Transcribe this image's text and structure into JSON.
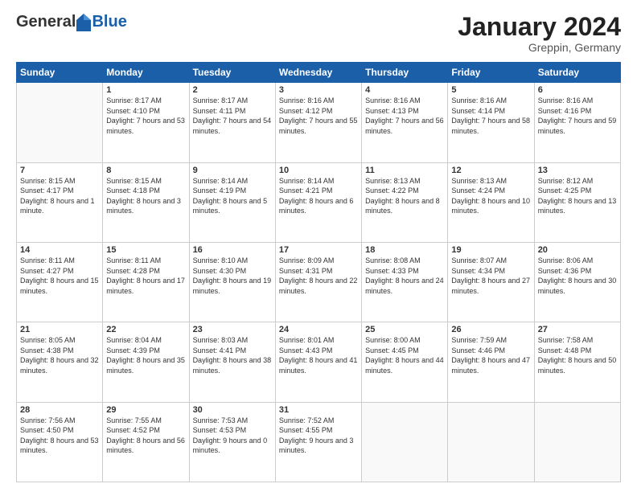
{
  "header": {
    "logo_general": "General",
    "logo_blue": "Blue",
    "month_title": "January 2024",
    "location": "Greppin, Germany"
  },
  "calendar": {
    "headers": [
      "Sunday",
      "Monday",
      "Tuesday",
      "Wednesday",
      "Thursday",
      "Friday",
      "Saturday"
    ],
    "weeks": [
      [
        {
          "day": "",
          "sunrise": "",
          "sunset": "",
          "daylight": "",
          "empty": true
        },
        {
          "day": "1",
          "sunrise": "Sunrise: 8:17 AM",
          "sunset": "Sunset: 4:10 PM",
          "daylight": "Daylight: 7 hours and 53 minutes."
        },
        {
          "day": "2",
          "sunrise": "Sunrise: 8:17 AM",
          "sunset": "Sunset: 4:11 PM",
          "daylight": "Daylight: 7 hours and 54 minutes."
        },
        {
          "day": "3",
          "sunrise": "Sunrise: 8:16 AM",
          "sunset": "Sunset: 4:12 PM",
          "daylight": "Daylight: 7 hours and 55 minutes."
        },
        {
          "day": "4",
          "sunrise": "Sunrise: 8:16 AM",
          "sunset": "Sunset: 4:13 PM",
          "daylight": "Daylight: 7 hours and 56 minutes."
        },
        {
          "day": "5",
          "sunrise": "Sunrise: 8:16 AM",
          "sunset": "Sunset: 4:14 PM",
          "daylight": "Daylight: 7 hours and 58 minutes."
        },
        {
          "day": "6",
          "sunrise": "Sunrise: 8:16 AM",
          "sunset": "Sunset: 4:16 PM",
          "daylight": "Daylight: 7 hours and 59 minutes."
        }
      ],
      [
        {
          "day": "7",
          "sunrise": "Sunrise: 8:15 AM",
          "sunset": "Sunset: 4:17 PM",
          "daylight": "Daylight: 8 hours and 1 minute."
        },
        {
          "day": "8",
          "sunrise": "Sunrise: 8:15 AM",
          "sunset": "Sunset: 4:18 PM",
          "daylight": "Daylight: 8 hours and 3 minutes."
        },
        {
          "day": "9",
          "sunrise": "Sunrise: 8:14 AM",
          "sunset": "Sunset: 4:19 PM",
          "daylight": "Daylight: 8 hours and 5 minutes."
        },
        {
          "day": "10",
          "sunrise": "Sunrise: 8:14 AM",
          "sunset": "Sunset: 4:21 PM",
          "daylight": "Daylight: 8 hours and 6 minutes."
        },
        {
          "day": "11",
          "sunrise": "Sunrise: 8:13 AM",
          "sunset": "Sunset: 4:22 PM",
          "daylight": "Daylight: 8 hours and 8 minutes."
        },
        {
          "day": "12",
          "sunrise": "Sunrise: 8:13 AM",
          "sunset": "Sunset: 4:24 PM",
          "daylight": "Daylight: 8 hours and 10 minutes."
        },
        {
          "day": "13",
          "sunrise": "Sunrise: 8:12 AM",
          "sunset": "Sunset: 4:25 PM",
          "daylight": "Daylight: 8 hours and 13 minutes."
        }
      ],
      [
        {
          "day": "14",
          "sunrise": "Sunrise: 8:11 AM",
          "sunset": "Sunset: 4:27 PM",
          "daylight": "Daylight: 8 hours and 15 minutes."
        },
        {
          "day": "15",
          "sunrise": "Sunrise: 8:11 AM",
          "sunset": "Sunset: 4:28 PM",
          "daylight": "Daylight: 8 hours and 17 minutes."
        },
        {
          "day": "16",
          "sunrise": "Sunrise: 8:10 AM",
          "sunset": "Sunset: 4:30 PM",
          "daylight": "Daylight: 8 hours and 19 minutes."
        },
        {
          "day": "17",
          "sunrise": "Sunrise: 8:09 AM",
          "sunset": "Sunset: 4:31 PM",
          "daylight": "Daylight: 8 hours and 22 minutes."
        },
        {
          "day": "18",
          "sunrise": "Sunrise: 8:08 AM",
          "sunset": "Sunset: 4:33 PM",
          "daylight": "Daylight: 8 hours and 24 minutes."
        },
        {
          "day": "19",
          "sunrise": "Sunrise: 8:07 AM",
          "sunset": "Sunset: 4:34 PM",
          "daylight": "Daylight: 8 hours and 27 minutes."
        },
        {
          "day": "20",
          "sunrise": "Sunrise: 8:06 AM",
          "sunset": "Sunset: 4:36 PM",
          "daylight": "Daylight: 8 hours and 30 minutes."
        }
      ],
      [
        {
          "day": "21",
          "sunrise": "Sunrise: 8:05 AM",
          "sunset": "Sunset: 4:38 PM",
          "daylight": "Daylight: 8 hours and 32 minutes."
        },
        {
          "day": "22",
          "sunrise": "Sunrise: 8:04 AM",
          "sunset": "Sunset: 4:39 PM",
          "daylight": "Daylight: 8 hours and 35 minutes."
        },
        {
          "day": "23",
          "sunrise": "Sunrise: 8:03 AM",
          "sunset": "Sunset: 4:41 PM",
          "daylight": "Daylight: 8 hours and 38 minutes."
        },
        {
          "day": "24",
          "sunrise": "Sunrise: 8:01 AM",
          "sunset": "Sunset: 4:43 PM",
          "daylight": "Daylight: 8 hours and 41 minutes."
        },
        {
          "day": "25",
          "sunrise": "Sunrise: 8:00 AM",
          "sunset": "Sunset: 4:45 PM",
          "daylight": "Daylight: 8 hours and 44 minutes."
        },
        {
          "day": "26",
          "sunrise": "Sunrise: 7:59 AM",
          "sunset": "Sunset: 4:46 PM",
          "daylight": "Daylight: 8 hours and 47 minutes."
        },
        {
          "day": "27",
          "sunrise": "Sunrise: 7:58 AM",
          "sunset": "Sunset: 4:48 PM",
          "daylight": "Daylight: 8 hours and 50 minutes."
        }
      ],
      [
        {
          "day": "28",
          "sunrise": "Sunrise: 7:56 AM",
          "sunset": "Sunset: 4:50 PM",
          "daylight": "Daylight: 8 hours and 53 minutes."
        },
        {
          "day": "29",
          "sunrise": "Sunrise: 7:55 AM",
          "sunset": "Sunset: 4:52 PM",
          "daylight": "Daylight: 8 hours and 56 minutes."
        },
        {
          "day": "30",
          "sunrise": "Sunrise: 7:53 AM",
          "sunset": "Sunset: 4:53 PM",
          "daylight": "Daylight: 9 hours and 0 minutes."
        },
        {
          "day": "31",
          "sunrise": "Sunrise: 7:52 AM",
          "sunset": "Sunset: 4:55 PM",
          "daylight": "Daylight: 9 hours and 3 minutes."
        },
        {
          "day": "",
          "sunrise": "",
          "sunset": "",
          "daylight": "",
          "empty": true
        },
        {
          "day": "",
          "sunrise": "",
          "sunset": "",
          "daylight": "",
          "empty": true
        },
        {
          "day": "",
          "sunrise": "",
          "sunset": "",
          "daylight": "",
          "empty": true
        }
      ]
    ]
  }
}
